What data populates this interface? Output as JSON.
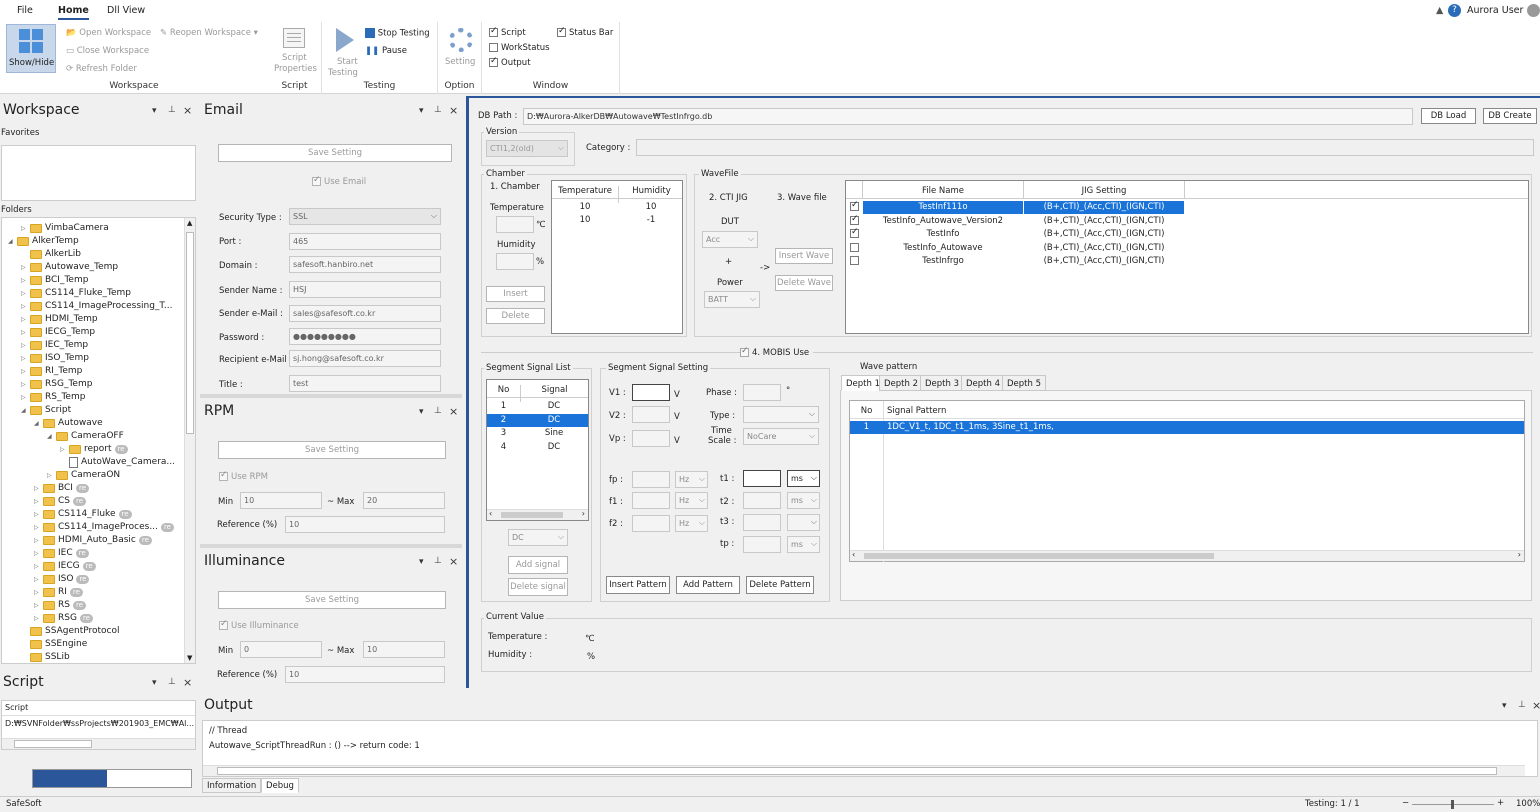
{
  "menu": {
    "file": "File",
    "home": "Home",
    "dll_view": "Dll View",
    "user": "Aurora User"
  },
  "ribbon": {
    "show_hide": "Show/Hide",
    "open_workspace": "Open Workspace",
    "reopen_workspace": "Reopen Workspace",
    "close_workspace": "Close Workspace",
    "refresh_folder": "Refresh Folder",
    "group_workspace": "Workspace",
    "script_properties_1": "Script",
    "script_properties_2": "Properties",
    "group_script": "Script",
    "start_testing_1": "Start",
    "start_testing_2": "Testing",
    "stop_testing": "Stop Testing",
    "pause": "Pause",
    "group_testing": "Testing",
    "setting": "Setting",
    "group_option": "Option",
    "chk_script": "Script",
    "chk_status_bar": "Status Bar",
    "chk_workstatus": "WorkStatus",
    "chk_output": "Output",
    "group_window": "Window"
  },
  "workspace": {
    "title": "Workspace",
    "favorites": "Favorites",
    "folders": "Folders",
    "tree": [
      {
        "label": "VimbaCamera",
        "indent": 1,
        "exp": "▷",
        "badge": ""
      },
      {
        "label": "AlkerTemp",
        "indent": 0,
        "exp": "◢",
        "badge": ""
      },
      {
        "label": "AlkerLib",
        "indent": 1,
        "exp": "",
        "badge": ""
      },
      {
        "label": "Autowave_Temp",
        "indent": 1,
        "exp": "▷",
        "badge": ""
      },
      {
        "label": "BCI_Temp",
        "indent": 1,
        "exp": "▷",
        "badge": ""
      },
      {
        "label": "CS114_Fluke_Temp",
        "indent": 1,
        "exp": "▷",
        "badge": ""
      },
      {
        "label": "CS114_ImageProcessing_T...",
        "indent": 1,
        "exp": "▷",
        "badge": ""
      },
      {
        "label": "HDMI_Temp",
        "indent": 1,
        "exp": "▷",
        "badge": ""
      },
      {
        "label": "IECG_Temp",
        "indent": 1,
        "exp": "▷",
        "badge": ""
      },
      {
        "label": "IEC_Temp",
        "indent": 1,
        "exp": "▷",
        "badge": ""
      },
      {
        "label": "ISO_Temp",
        "indent": 1,
        "exp": "▷",
        "badge": ""
      },
      {
        "label": "RI_Temp",
        "indent": 1,
        "exp": "▷",
        "badge": ""
      },
      {
        "label": "RSG_Temp",
        "indent": 1,
        "exp": "▷",
        "badge": ""
      },
      {
        "label": "RS_Temp",
        "indent": 1,
        "exp": "▷",
        "badge": ""
      },
      {
        "label": "Script",
        "indent": 1,
        "exp": "◢",
        "badge": ""
      },
      {
        "label": "Autowave",
        "indent": 2,
        "exp": "◢",
        "badge": ""
      },
      {
        "label": "CameraOFF",
        "indent": 3,
        "exp": "◢",
        "badge": ""
      },
      {
        "label": "report",
        "indent": 4,
        "exp": "▷",
        "badge": "re"
      },
      {
        "label": "AutoWave_Camera...",
        "indent": 4,
        "exp": "",
        "badge": "",
        "file": true
      },
      {
        "label": "CameraON",
        "indent": 3,
        "exp": "▷",
        "badge": ""
      },
      {
        "label": "BCI",
        "indent": 2,
        "exp": "▷",
        "badge": "re"
      },
      {
        "label": "CS",
        "indent": 2,
        "exp": "▷",
        "badge": "re"
      },
      {
        "label": "CS114_Fluke",
        "indent": 2,
        "exp": "▷",
        "badge": "re"
      },
      {
        "label": "CS114_ImageProces...",
        "indent": 2,
        "exp": "▷",
        "badge": "re"
      },
      {
        "label": "HDMI_Auto_Basic",
        "indent": 2,
        "exp": "▷",
        "badge": "re"
      },
      {
        "label": "IEC",
        "indent": 2,
        "exp": "▷",
        "badge": "re"
      },
      {
        "label": "IECG",
        "indent": 2,
        "exp": "▷",
        "badge": "re"
      },
      {
        "label": "ISO",
        "indent": 2,
        "exp": "▷",
        "badge": "re"
      },
      {
        "label": "RI",
        "indent": 2,
        "exp": "▷",
        "badge": "re"
      },
      {
        "label": "RS",
        "indent": 2,
        "exp": "▷",
        "badge": "re"
      },
      {
        "label": "RSG",
        "indent": 2,
        "exp": "▷",
        "badge": "re"
      },
      {
        "label": "SSAgentProtocol",
        "indent": 1,
        "exp": "",
        "badge": ""
      },
      {
        "label": "SSEngine",
        "indent": 1,
        "exp": "",
        "badge": ""
      },
      {
        "label": "SSLib",
        "indent": 1,
        "exp": "",
        "badge": ""
      }
    ]
  },
  "script_panel": {
    "title": "Script",
    "header": "Script",
    "path": "D:₩SVNFolder₩ssProjects₩201903_EMC₩Al..."
  },
  "email": {
    "title": "Email",
    "save": "Save Setting",
    "use_email": "Use Email",
    "security_type_label": "Security Type :",
    "security_type": "SSL",
    "port_label": "Port :",
    "port": "465",
    "domain_label": "Domain :",
    "domain": "safesoft.hanbiro.net",
    "sender_name_label": "Sender Name :",
    "sender_name": "HSJ",
    "sender_email_label": "Sender e-Mail :",
    "sender_email": "sales@safesoft.co.kr",
    "password_label": "Password :",
    "password": "●●●●●●●●●",
    "recipient_label": "Recipient e-Mail :",
    "recipient": "sj.hong@safesoft.co.kr",
    "title_label": "Title :",
    "title_value": "test"
  },
  "rpm": {
    "title": "RPM",
    "save": "Save Setting",
    "use": "Use RPM",
    "min_label": "Min",
    "min": "10",
    "max_label": "~ Max",
    "max": "20",
    "ref_label": "Reference (%)",
    "ref": "10"
  },
  "illuminance": {
    "title": "Illuminance",
    "save": "Save Setting",
    "use": "Use Illuminance",
    "min_label": "Min",
    "min": "0",
    "max_label": "~ Max",
    "max": "10",
    "ref_label": "Reference (%)",
    "ref": "10"
  },
  "main": {
    "db_path_label": "DB Path :",
    "db_path": "D:₩Aurora-AlkerDB₩Autowave₩TestInfrgo.db",
    "db_load": "DB Load",
    "db_create": "DB Create",
    "version_label": "Version",
    "version": "CTI1,2(old)",
    "category_label": "Category :",
    "chamber": "Chamber",
    "chamber_1": "1. Chamber",
    "temperature": "Temperature",
    "humidity": "Humidity",
    "deg": "℃",
    "pct": "%",
    "insert": "Insert",
    "delete": "Delete",
    "chamber_table": {
      "headers": [
        "Temperature",
        "Humidity"
      ],
      "rows": [
        [
          "10",
          "10"
        ],
        [
          "10",
          "-1"
        ]
      ]
    },
    "wavefile": "WaveFile",
    "cti_jig": "2. CTI JIG",
    "wave_file": "3. Wave file",
    "dut": "DUT",
    "dut_value": "Acc",
    "plus": "+",
    "power": "Power",
    "power_value": "BATT",
    "arrow": "->",
    "insert_wave": "Insert Wave",
    "delete_wave": "Delete Wave",
    "wave_table": {
      "headers": [
        "File Name",
        "JIG Setting"
      ],
      "rows": [
        {
          "checked": true,
          "name": "TestInf111o",
          "jig": "(B+,CTI)_(Acc,CTI)_(IGN,CTI)",
          "sel": true
        },
        {
          "checked": true,
          "name": "TestInfo_Autowave_Version2",
          "jig": "(B+,CTI)_(Acc,CTI)_(IGN,CTI)",
          "sel": false
        },
        {
          "checked": true,
          "name": "TestInfo",
          "jig": "(B+,CTI)_(Acc,CTI)_(IGN,CTI)",
          "sel": false
        },
        {
          "checked": false,
          "name": "TestInfo_Autowave",
          "jig": "(B+,CTI)_(Acc,CTI)_(IGN,CTI)",
          "sel": false
        },
        {
          "checked": false,
          "name": "TestInfrgo",
          "jig": "(B+,CTI)_(Acc,CTI)_(IGN,CTI)",
          "sel": false
        }
      ]
    },
    "mobis": "4. MOBIS Use",
    "segment_list": "Segment Signal List",
    "seg_headers": [
      "No",
      "Signal"
    ],
    "seg_rows": [
      {
        "no": "1",
        "sig": "DC",
        "sel": false
      },
      {
        "no": "2",
        "sig": "DC",
        "sel": true
      },
      {
        "no": "3",
        "sig": "Sine",
        "sel": false
      },
      {
        "no": "4",
        "sig": "DC",
        "sel": false
      }
    ],
    "seg_type": "DC",
    "add_signal": "Add signal",
    "delete_signal": "Delete signal",
    "segment_setting": "Segment Signal Setting",
    "v1": "V1 :",
    "v2": "V2 :",
    "vp": "Vp :",
    "v": "V",
    "phase": "Phase :",
    "degsym": "°",
    "type": "Type :",
    "time_scale_1": "Time",
    "time_scale_2": "Scale :",
    "time_scale": "NoCare",
    "fp": "fp :",
    "f1": "f1 :",
    "f2": "f2 :",
    "hz": "Hz",
    "t1": "t1 :",
    "t2": "t2 :",
    "t3": "t3 :",
    "tp": "tp :",
    "ms": "ms",
    "insert_pattern": "Insert Pattern",
    "add_pattern": "Add Pattern",
    "delete_pattern": "Delete Pattern",
    "wave_pattern": "Wave pattern",
    "depth_tabs": [
      "Depth 1",
      "Depth 2",
      "Depth 3",
      "Depth 4",
      "Depth 5"
    ],
    "pattern_headers": [
      "No",
      "Signal Pattern"
    ],
    "pattern_rows": [
      {
        "no": "1",
        "pattern": "1DC_V1_t, 1DC_t1_1ms, 3Sine_t1_1ms,"
      }
    ],
    "current_value": "Current Value",
    "cur_temp": "Temperature :",
    "cur_temp_unit": "℃",
    "cur_hum": "Humidity :",
    "cur_hum_unit": "%"
  },
  "output": {
    "title": "Output",
    "line1": "// Thread",
    "line2": "Autowave_ScriptThreadRun :  ()  --> return code: 1",
    "tab_information": "Information",
    "tab_debug": "Debug"
  },
  "status": {
    "left": "SafeSoft",
    "testing": "Testing: 1 / 1",
    "zoom": "100%",
    "progress": 0.47
  },
  "colors": {
    "selection": "#1a73d9",
    "progress": "#2b579a"
  }
}
